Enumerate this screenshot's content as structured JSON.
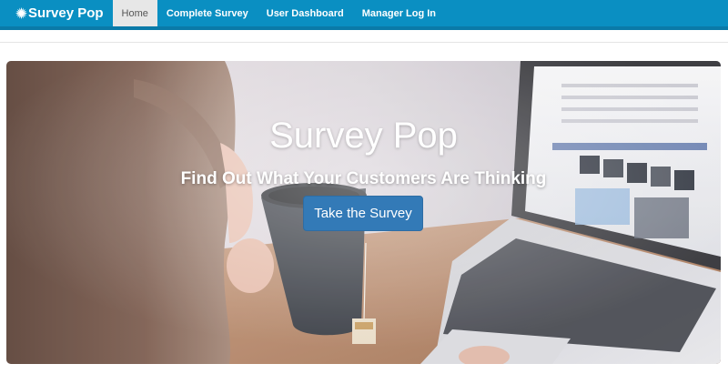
{
  "navbar": {
    "brand": "Survey Pop",
    "brand_icon": "sun-burst-icon",
    "bg_color": "#0a8fc2",
    "items": [
      {
        "label": "Home",
        "active": true
      },
      {
        "label": "Complete Survey",
        "active": false
      },
      {
        "label": "User Dashboard",
        "active": false
      },
      {
        "label": "Manager Log In",
        "active": false
      }
    ]
  },
  "hero": {
    "title": "Survey Pop",
    "subtitle": "Find Out What Your Customers Are Thinking",
    "button_label": "Take the Survey",
    "button_color": "#337ab7",
    "background_image": "woman-drinking-tea-at-laptop-photo"
  }
}
